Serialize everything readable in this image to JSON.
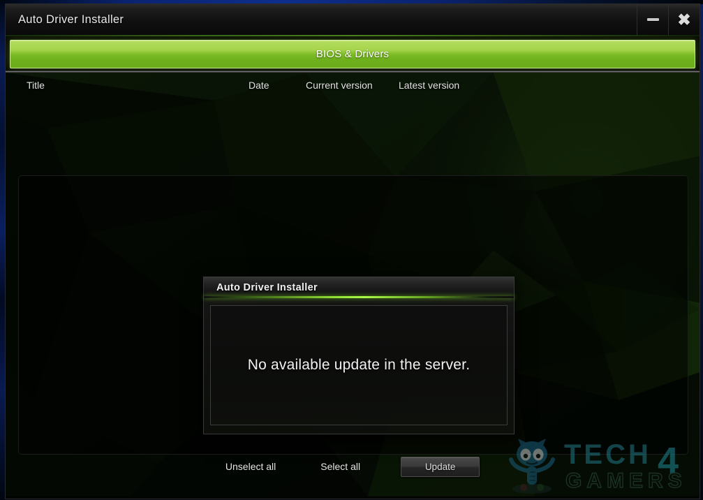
{
  "window": {
    "title": "Auto Driver Installer",
    "controls": {
      "minimize_label": "—",
      "close_label": "✖"
    }
  },
  "tabs": [
    {
      "label": "BIOS & Drivers",
      "active": true
    }
  ],
  "table": {
    "columns": [
      "Title",
      "Date",
      "Current version",
      "Latest version"
    ],
    "rows": []
  },
  "footer": {
    "unselect_all_label": "Unselect all",
    "select_all_label": "Select all",
    "update_label": "Update"
  },
  "dialog": {
    "title": "Auto Driver Installer",
    "message": "No available update in the server."
  },
  "watermark": {
    "line1": "TECH",
    "digit": "4",
    "line2": "GAMERS"
  },
  "colors": {
    "accent_green_light": "#b4dc60",
    "accent_green_dark": "#6aac1a",
    "glow_green": "#a8fa46",
    "window_bg": "#050505",
    "titlebar_bg": "#1d1d1d",
    "text_primary": "#e9e9e9",
    "desktop_blue": "#0d2e8c"
  }
}
